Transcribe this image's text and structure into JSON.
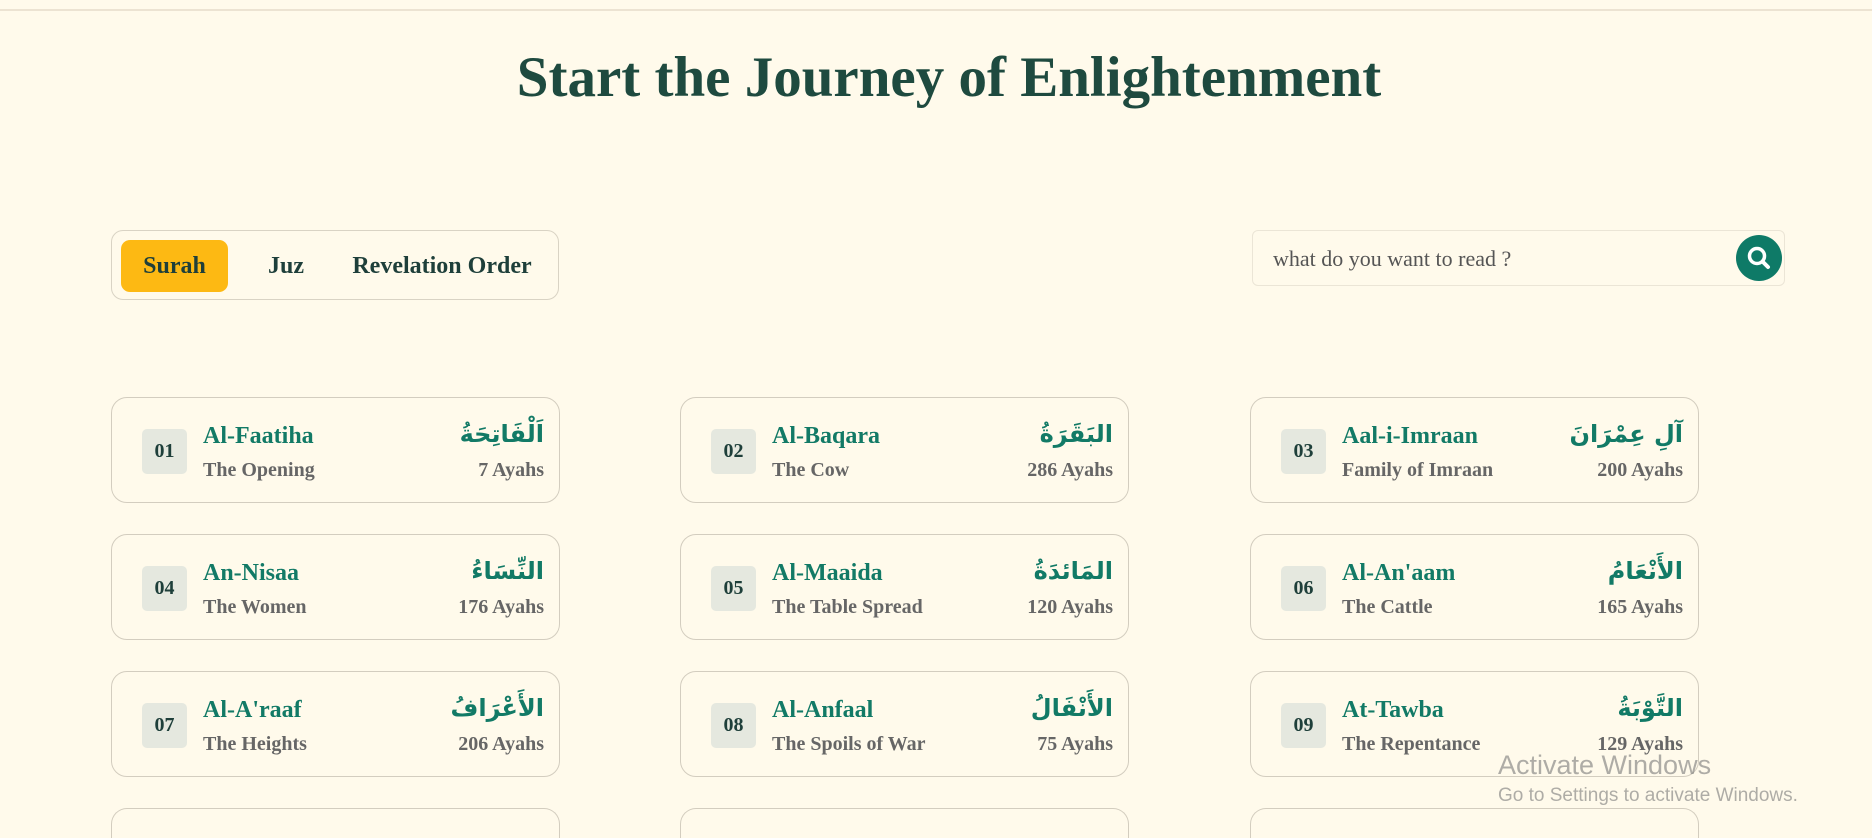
{
  "hero": {
    "title": "Start the Journey of Enlightenment"
  },
  "tabs": [
    {
      "label": "Surah",
      "active": true
    },
    {
      "label": "Juz",
      "active": false
    },
    {
      "label": "Revelation Order",
      "active": false
    }
  ],
  "search": {
    "placeholder": "what do you want to read ?",
    "value": "",
    "icon": "search-icon"
  },
  "colors": {
    "background": "#fffaeb",
    "accent": "#fdb913",
    "primary": "#127a66",
    "title": "#1e4a3f"
  },
  "surahs": [
    {
      "number": "01",
      "name": "Al-Faatiha",
      "arabic": "اَلْفَاتِحَةُ",
      "meaning": "The Opening",
      "ayahs": "7 Ayahs"
    },
    {
      "number": "02",
      "name": "Al-Baqara",
      "arabic": "البَقَرَةُ",
      "meaning": "The Cow",
      "ayahs": "286 Ayahs"
    },
    {
      "number": "03",
      "name": "Aal-i-Imraan",
      "arabic": "آلِ عِمْرَانَ",
      "meaning": "Family of Imraan",
      "ayahs": "200 Ayahs"
    },
    {
      "number": "04",
      "name": "An-Nisaa",
      "arabic": "النِّسَاءُ",
      "meaning": "The Women",
      "ayahs": "176 Ayahs"
    },
    {
      "number": "05",
      "name": "Al-Maaida",
      "arabic": "المَائدَةُ",
      "meaning": "The Table Spread",
      "ayahs": "120 Ayahs"
    },
    {
      "number": "06",
      "name": "Al-An'aam",
      "arabic": "الأَنْعَامُ",
      "meaning": "The Cattle",
      "ayahs": "165 Ayahs"
    },
    {
      "number": "07",
      "name": "Al-A'raaf",
      "arabic": "الأَعْرَافُ",
      "meaning": "The Heights",
      "ayahs": "206 Ayahs"
    },
    {
      "number": "08",
      "name": "Al-Anfaal",
      "arabic": "الأَنْفَالُ",
      "meaning": "The Spoils of War",
      "ayahs": "75 Ayahs"
    },
    {
      "number": "09",
      "name": "At-Tawba",
      "arabic": "التَّوْبَةُ",
      "meaning": "The Repentance",
      "ayahs": "129 Ayahs"
    }
  ],
  "watermark": {
    "line1": "Activate Windows",
    "line2": "Go to Settings to activate Windows."
  }
}
